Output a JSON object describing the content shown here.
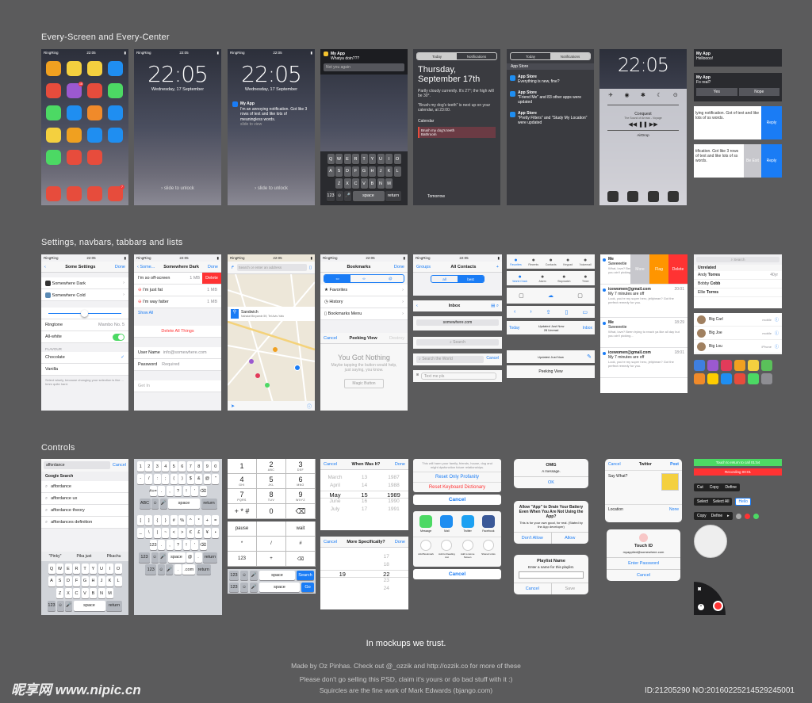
{
  "sections": {
    "every_screen": "Every-Screen and Every-Center",
    "settings": "Settings, navbars, tabbars and lists",
    "controls": "Controls"
  },
  "status": {
    "carrier": "RingRing",
    "time": "22:05"
  },
  "lock": {
    "time": "22:05",
    "date": "Wednesday, 17 September",
    "slide": "slide to unlock"
  },
  "notif": {
    "app": "My App",
    "message": "I'm an annoying notification. Got like 3 rows of text and like lots of meaningless words.",
    "slide": "slide to view",
    "whatya": "Whatya doin???",
    "placeholder": "Not you again"
  },
  "today": {
    "tab_today": "Today",
    "tab_notifications": "Notifications",
    "heading": "Thursday, September 17th",
    "weather": "Partly cloudy currently. It's 27°; the high will be 30°.",
    "brush": "\"Brush my dog's teeth\" is next up on your calendar, at 23:00.",
    "calendar": "Calendar",
    "event": "Brush my dog's teeth",
    "event_place": "Bathroom",
    "tomorrow": "Tomorrow"
  },
  "notifications_center": {
    "items": [
      {
        "app": "App Store",
        "msg": "Everything is new, fine?"
      },
      {
        "app": "App Store",
        "msg": "\"Friend Me\" and 83 other apps were updated"
      },
      {
        "app": "App Store",
        "msg": "\"Pretty Filters\" and \"Study My Location\" were updated"
      }
    ]
  },
  "control_center": {
    "song": "Conquest",
    "artist": "The Sound of Arrows - Voyage",
    "airdrop": "AirDrop"
  },
  "banner": {
    "app": "My App",
    "hello": "Helloooo!",
    "question": "Fo real?",
    "yes": "Yes",
    "nope": "Nope",
    "row1": "lying notification. Got of text and like lots of ss words.",
    "row2": "tification. Got like 3 rows of text and like lots of ss words.",
    "reply": "Reply",
    "be_exit": "Be Exit"
  },
  "settings": {
    "back": "Some Settings",
    "done": "Done",
    "dark": "Somewhere Dark",
    "cold": "Somewhere Cold",
    "ringtone": "Ringtone",
    "ringtone_val": "Mambo No. 5",
    "all_white": "All-white",
    "flavour": "FLAVOUR",
    "chocolate": "Chocolate",
    "vanilla": "Vanilla",
    "note": "Select wisely, because changing your selection is like ... hmm quite hard."
  },
  "edit_list": {
    "back": "Some...",
    "title": "Somewhere Dark",
    "done": "Done",
    "offscreen": "I'm so off-screen",
    "offscreen_size": "1 MB",
    "fat": "I'm just fat",
    "fat_size": "1 MB",
    "fatter": "I'm way fatter",
    "fatter_size": "1 MB",
    "show_all": "Show All",
    "delete": "Delete",
    "delete_all": "Delete All Things",
    "user_name": "User Name",
    "user_placeholder": "info@somewhere.com",
    "password": "Password",
    "password_placeholder": "Required",
    "get_in": "Get In"
  },
  "map": {
    "search": "Search or enter an address",
    "place": "Sandwich",
    "address": "Nahalat Binyamin 59, Tel Aviv-Yafo"
  },
  "bookmarks": {
    "title": "Bookmarks",
    "done": "Done",
    "favorites": "Favorites",
    "history": "History",
    "menu": "Bookmarks Menu",
    "cancel": "Cancel",
    "peeking": "Peeking View",
    "destroy": "Destroy",
    "nothing": "You Got Nothing",
    "nothing_sub": "Maybe tapping the button would help, just saying, you know.",
    "magic": "Magic Button"
  },
  "contacts": {
    "groups": "Groups",
    "title": "All Contacts",
    "plus": "+",
    "seg_all": "all",
    "seg_best": "best",
    "inbox": "Inbox",
    "url": "somewhere.com",
    "search": "Search",
    "search_world": "Search the World",
    "cancel": "Cancel",
    "text_me": "Text me pls"
  },
  "tabbars": {
    "tabs1": [
      "Favorites",
      "Recents",
      "Contacts",
      "Keypad",
      "Voicemail"
    ],
    "tabs2": [
      "World Clock",
      "Alarm",
      "Stopwatch",
      "Timer"
    ],
    "today": "Today",
    "updated": "Updated Just Now",
    "unread": "28 Unread",
    "inbox": "Inbox",
    "updated2": "Updated Just Now",
    "peeking": "Peeking View"
  },
  "mail": [
    {
      "from": "Me",
      "time": "21:30",
      "subject": "Sweeeetie",
      "body": "What, love? Been trying to reach ya like all day but you ain't picking up your pho..."
    },
    {
      "from": "icewomen@gmail.com",
      "time": "20:01",
      "subject": "My 7 minutes are off",
      "body": "Look, you're my super hero, jellybean? Got the perfect remedy for you."
    },
    {
      "from": "Me",
      "time": "18:29",
      "subject": "Sweeeetie",
      "body": "What, love? Been trying to reach ya like all day but you ain't picking..."
    },
    {
      "from": "icewomen@gmail.com",
      "time": "18:01",
      "subject": "My 7 minutes are off",
      "body": "Look, you're my super hero, jellybean? Got the perfect remedy for you."
    }
  ],
  "mail_actions": {
    "more": "More",
    "flag": "Flag",
    "delete": "Delete"
  },
  "people": {
    "search": "Search",
    "unrelated": "Unrelated",
    "rows": [
      {
        "first": "Andy",
        "last": "Torres",
        "meta": "40yr"
      },
      {
        "first": "Bobby",
        "last": "Cobb",
        "meta": ""
      },
      {
        "first": "Ellie",
        "last": "Torres",
        "meta": ""
      }
    ],
    "big": [
      {
        "name": "Big Carl",
        "meta": "mobile"
      },
      {
        "name": "Big Joe",
        "meta": "mobile"
      },
      {
        "name": "Big Lou",
        "meta": "iPhone"
      }
    ]
  },
  "search_kbd": {
    "query": "affordance",
    "cancel": "Cancel",
    "header": "Google Search",
    "results": [
      "affordance",
      "affordance ux",
      "affordance theory",
      "affordances definition"
    ],
    "suggest": [
      "\"Pinky\"",
      "Pika just",
      "Pikachu"
    ],
    "popup": "P",
    "rows": [
      [
        "Q",
        "W",
        "E",
        "R",
        "T",
        "Y",
        "U",
        "I",
        "O"
      ],
      [
        "A",
        "S",
        "D",
        "F",
        "G",
        "H",
        "J",
        "K",
        "L"
      ],
      [
        "Z",
        "X",
        "C",
        "V",
        "B",
        "N",
        "M"
      ]
    ],
    "space": "space",
    "return": "return",
    "num": "123"
  },
  "sym_kbd": {
    "row1": [
      "1",
      "2",
      "3",
      "4",
      "5",
      "6",
      "7",
      "8",
      "9",
      "0"
    ],
    "row2": [
      "-",
      "/",
      ":",
      ";",
      "(",
      ")",
      "$",
      "&",
      "@",
      "\""
    ],
    "row3": [
      ".",
      ",",
      "?",
      "!",
      "'"
    ],
    "row1b": [
      "[",
      "]",
      "{",
      "}",
      "#",
      "%",
      "^",
      "*",
      "+",
      "="
    ],
    "row2b": [
      "_",
      "\\",
      "|",
      "~",
      "<",
      ">",
      "€",
      "£",
      "¥",
      "•"
    ],
    "abc": "ABC",
    "space": "space",
    "return": "return",
    "at": "@",
    "dot": ".",
    "com": ".com",
    "num": "123"
  },
  "dialpad": {
    "keys": [
      {
        "n": "1",
        "l": ""
      },
      {
        "n": "2",
        "l": "ABC"
      },
      {
        "n": "3",
        "l": "DEF"
      },
      {
        "n": "4",
        "l": "GHI"
      },
      {
        "n": "5",
        "l": "JKL"
      },
      {
        "n": "6",
        "l": "MNO"
      },
      {
        "n": "7",
        "l": "PQRS"
      },
      {
        "n": "8",
        "l": "TUV"
      },
      {
        "n": "9",
        "l": "WXYZ"
      },
      {
        "n": "+ * #",
        "l": ""
      },
      {
        "n": "0",
        "l": ""
      },
      {
        "n": "⌫",
        "l": ""
      }
    ],
    "pause": "pause",
    "wait": "wait",
    "num": "123",
    "space": "space",
    "search": "Search",
    "go": "Go"
  },
  "date_picker": {
    "cancel": "Cancel",
    "title": "When Was It?",
    "done": "Done",
    "rows": [
      [
        "March",
        "13",
        "1987"
      ],
      [
        "April",
        "14",
        "1988"
      ],
      [
        "May",
        "15",
        "1989"
      ],
      [
        "June",
        "16",
        "1990"
      ],
      [
        "July",
        "17",
        "1991"
      ]
    ],
    "title2": "More Specifically?",
    "rows2": [
      [
        "",
        "17"
      ],
      [
        "",
        "18"
      ],
      [
        "19",
        "22"
      ],
      [
        "",
        "23"
      ],
      [
        "",
        "24"
      ]
    ]
  },
  "action_sheet": {
    "message": "This will harm your family, friends, house, dog and might dysfunction future relationships.",
    "profanity": "Reset Only Profanity",
    "keyboard": "Reset Keyboard Dictionary",
    "cancel": "Cancel",
    "share": [
      "Message",
      "Mail",
      "Twitter",
      "Facebook"
    ],
    "actions": [
      "Add Bookmark",
      "Add to Reading List",
      "Add to Home Screen",
      "Shared Links"
    ]
  },
  "alerts": {
    "omg": "OMG",
    "omg_msg": "A message.",
    "ok": "OK",
    "drain": "Allow \"App\" to Drain Your Battery Even When You Are Not Using the App?",
    "drain_msg": "This is for your own good, for real. (Stated by the App developer)",
    "dont": "Don't Allow",
    "allow": "Allow",
    "playlist": "Playlist Name",
    "playlist_msg": "Enter a name for this playlist.",
    "cancel": "Cancel",
    "save": "Save"
  },
  "twitter": {
    "cancel": "Cancel",
    "title": "Twitter",
    "post": "Post",
    "text": "Say What?",
    "location": "Location",
    "none": "None"
  },
  "touchid": {
    "title": "Touch ID",
    "email": "myapplied@somewhere.com",
    "enter": "Enter Password",
    "cancel": "Cancel"
  },
  "misc": {
    "touch_return": "Touch to return to call 01:54",
    "recording": "Recording 00:01",
    "cut": "Cut",
    "copy": "Copy",
    "define": "Define",
    "select": "Select",
    "select_all": "Select All",
    "hello": "Hello",
    "paste": "Copy"
  },
  "colors": [
    "#3f7fe0",
    "#9b59d0",
    "#e23b5a",
    "#f0a020",
    "#f4d03f",
    "#5ac05a",
    "#f08a2a",
    "#ffcc00",
    "#1f8ef1",
    "#e74c3c",
    "#4cd964",
    "#8e8e93"
  ],
  "footer": {
    "tagline": "In mockups we trust.",
    "made_by": "Made by Oz Pinhas. Check out @_ozzik and http://ozzik.co for more of these",
    "please": "Please don't go selling this PSD, claim it's yours or do bad stuff with it :)",
    "squircles": "Squircles are the fine work of Mark Edwards (bjango.com)",
    "watermark": "昵享网 www.nipic.cn",
    "id": "ID:21205290 NO:20160225214529245001"
  }
}
